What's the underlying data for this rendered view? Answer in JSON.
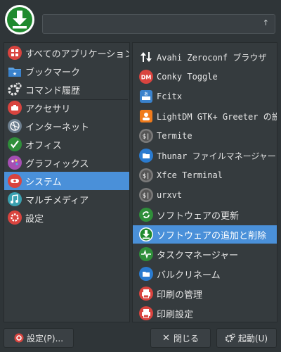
{
  "search": {
    "value": "",
    "clear_icon": "clear-arrow-icon"
  },
  "categories": [
    {
      "label": "すべてのアプリケーション",
      "icon": "grid-apps-icon"
    },
    {
      "label": "ブックマーク",
      "icon": "bookmark-folder-icon"
    },
    {
      "label": "コマンド履歴",
      "icon": "gears-history-icon"
    },
    {
      "label": "アクセサリ",
      "icon": "accessories-icon"
    },
    {
      "label": "インターネット",
      "icon": "internet-globe-icon"
    },
    {
      "label": "オフィス",
      "icon": "office-check-icon"
    },
    {
      "label": "グラフィックス",
      "icon": "graphics-palette-icon"
    },
    {
      "label": "システム",
      "icon": "system-icon",
      "selected": true
    },
    {
      "label": "マルチメディア",
      "icon": "multimedia-icon"
    },
    {
      "label": "設定",
      "icon": "settings-gear-icon"
    }
  ],
  "apps": [
    {
      "label": "Avahi Zeroconf ブラウザ",
      "icon": "updown-arrows-icon"
    },
    {
      "label": "Conky Toggle",
      "icon": "conky-icon"
    },
    {
      "label": "Fcitx",
      "icon": "fcitx-keyboard-icon"
    },
    {
      "label": "LightDM GTK+ Greeter の設定",
      "icon": "lightdm-user-icon"
    },
    {
      "label": "Termite",
      "icon": "terminal-icon"
    },
    {
      "label": "Thunar ファイルマネージャー",
      "icon": "folder-icon"
    },
    {
      "label": "Xfce Terminal",
      "icon": "terminal-icon"
    },
    {
      "label": "urxvt",
      "icon": "terminal-icon"
    },
    {
      "label": "ソフトウェアの更新",
      "icon": "update-refresh-icon"
    },
    {
      "label": "ソフトウェアの追加と削除",
      "icon": "download-install-icon",
      "selected": true
    },
    {
      "label": "タスクマネージャー",
      "icon": "task-pulse-icon"
    },
    {
      "label": "バルクリネーム",
      "icon": "folder-icon"
    },
    {
      "label": "印刷の管理",
      "icon": "printer-icon"
    },
    {
      "label": "印刷設定",
      "icon": "printer-icon"
    }
  ],
  "buttons": {
    "settings": "設定(P)...",
    "close": "閉じる",
    "launch": "起動(U)"
  },
  "colors": {
    "background": "#2f3538",
    "selection": "#4a90d9",
    "logo_green": "#1f8a2e",
    "red_icon": "#d9443f"
  }
}
